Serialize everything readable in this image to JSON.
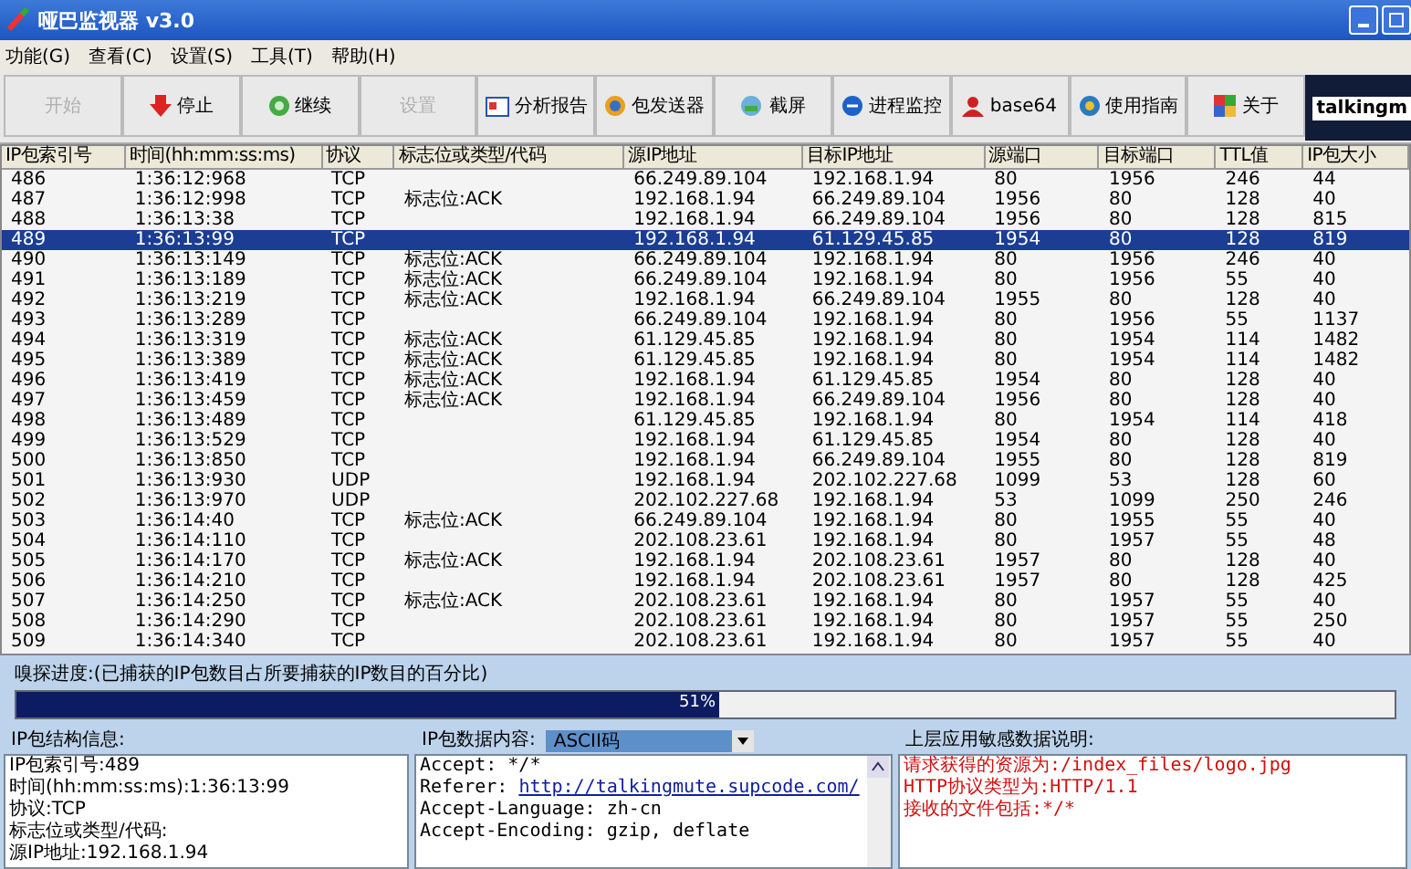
{
  "window": {
    "title": "哑巴监视器 v3.0"
  },
  "menu": [
    "功能(G)",
    "查看(C)",
    "设置(S)",
    "工具(T)",
    "帮助(H)"
  ],
  "toolbar": [
    {
      "label": "开始",
      "disabled": true
    },
    {
      "label": "停止",
      "disabled": false
    },
    {
      "label": "继续",
      "disabled": false
    },
    {
      "label": "设置",
      "disabled": true
    },
    {
      "label": "分析报告",
      "disabled": false
    },
    {
      "label": "包发送器",
      "disabled": false
    },
    {
      "label": "截屏",
      "disabled": false
    },
    {
      "label": "进程监控",
      "disabled": false
    },
    {
      "label": "base64",
      "disabled": false
    },
    {
      "label": "使用指南",
      "disabled": false
    },
    {
      "label": "关于",
      "disabled": false
    }
  ],
  "logo": "talkingm",
  "table": {
    "columns": [
      "IP包索引号",
      "时间(hh:mm:ss:ms)",
      "协议",
      "标志位或类型/代码",
      "源IP地址",
      "目标IP地址",
      "源端口",
      "目标端口",
      "TTL值",
      "IP包大小"
    ],
    "rows": [
      {
        "cells": [
          "486",
          "1:36:12:968",
          "TCP",
          "",
          "66.249.89.104",
          "192.168.1.94",
          "80",
          "1956",
          "246",
          "44"
        ],
        "selected": false
      },
      {
        "cells": [
          "487",
          "1:36:12:998",
          "TCP",
          "标志位:ACK",
          "192.168.1.94",
          "66.249.89.104",
          "1956",
          "80",
          "128",
          "40"
        ],
        "selected": false
      },
      {
        "cells": [
          "488",
          "1:36:13:38",
          "TCP",
          "",
          "192.168.1.94",
          "66.249.89.104",
          "1956",
          "80",
          "128",
          "815"
        ],
        "selected": false
      },
      {
        "cells": [
          "489",
          "1:36:13:99",
          "TCP",
          "",
          "192.168.1.94",
          "61.129.45.85",
          "1954",
          "80",
          "128",
          "819"
        ],
        "selected": true
      },
      {
        "cells": [
          "490",
          "1:36:13:149",
          "TCP",
          "标志位:ACK",
          "66.249.89.104",
          "192.168.1.94",
          "80",
          "1956",
          "246",
          "40"
        ],
        "selected": false
      },
      {
        "cells": [
          "491",
          "1:36:13:189",
          "TCP",
          "标志位:ACK",
          "66.249.89.104",
          "192.168.1.94",
          "80",
          "1956",
          "55",
          "40"
        ],
        "selected": false
      },
      {
        "cells": [
          "492",
          "1:36:13:219",
          "TCP",
          "标志位:ACK",
          "192.168.1.94",
          "66.249.89.104",
          "1955",
          "80",
          "128",
          "40"
        ],
        "selected": false
      },
      {
        "cells": [
          "493",
          "1:36:13:289",
          "TCP",
          "",
          "66.249.89.104",
          "192.168.1.94",
          "80",
          "1956",
          "55",
          "1137"
        ],
        "selected": false
      },
      {
        "cells": [
          "494",
          "1:36:13:319",
          "TCP",
          "标志位:ACK",
          "61.129.45.85",
          "192.168.1.94",
          "80",
          "1954",
          "114",
          "1482"
        ],
        "selected": false
      },
      {
        "cells": [
          "495",
          "1:36:13:389",
          "TCP",
          "标志位:ACK",
          "61.129.45.85",
          "192.168.1.94",
          "80",
          "1954",
          "114",
          "1482"
        ],
        "selected": false
      },
      {
        "cells": [
          "496",
          "1:36:13:419",
          "TCP",
          "标志位:ACK",
          "192.168.1.94",
          "61.129.45.85",
          "1954",
          "80",
          "128",
          "40"
        ],
        "selected": false
      },
      {
        "cells": [
          "497",
          "1:36:13:459",
          "TCP",
          "标志位:ACK",
          "192.168.1.94",
          "66.249.89.104",
          "1956",
          "80",
          "128",
          "40"
        ],
        "selected": false
      },
      {
        "cells": [
          "498",
          "1:36:13:489",
          "TCP",
          "",
          "61.129.45.85",
          "192.168.1.94",
          "80",
          "1954",
          "114",
          "418"
        ],
        "selected": false
      },
      {
        "cells": [
          "499",
          "1:36:13:529",
          "TCP",
          "",
          "192.168.1.94",
          "61.129.45.85",
          "1954",
          "80",
          "128",
          "40"
        ],
        "selected": false
      },
      {
        "cells": [
          "500",
          "1:36:13:850",
          "TCP",
          "",
          "192.168.1.94",
          "66.249.89.104",
          "1955",
          "80",
          "128",
          "819"
        ],
        "selected": false
      },
      {
        "cells": [
          "501",
          "1:36:13:930",
          "UDP",
          "",
          "192.168.1.94",
          "202.102.227.68",
          "1099",
          "53",
          "128",
          "60"
        ],
        "selected": false
      },
      {
        "cells": [
          "502",
          "1:36:13:970",
          "UDP",
          "",
          "202.102.227.68",
          "192.168.1.94",
          "53",
          "1099",
          "250",
          "246"
        ],
        "selected": false
      },
      {
        "cells": [
          "503",
          "1:36:14:40",
          "TCP",
          "标志位:ACK",
          "66.249.89.104",
          "192.168.1.94",
          "80",
          "1955",
          "55",
          "40"
        ],
        "selected": false
      },
      {
        "cells": [
          "504",
          "1:36:14:110",
          "TCP",
          "",
          "202.108.23.61",
          "192.168.1.94",
          "80",
          "1957",
          "55",
          "48"
        ],
        "selected": false
      },
      {
        "cells": [
          "505",
          "1:36:14:170",
          "TCP",
          "标志位:ACK",
          "192.168.1.94",
          "202.108.23.61",
          "1957",
          "80",
          "128",
          "40"
        ],
        "selected": false
      },
      {
        "cells": [
          "506",
          "1:36:14:210",
          "TCP",
          "",
          "192.168.1.94",
          "202.108.23.61",
          "1957",
          "80",
          "128",
          "425"
        ],
        "selected": false
      },
      {
        "cells": [
          "507",
          "1:36:14:250",
          "TCP",
          "标志位:ACK",
          "202.108.23.61",
          "192.168.1.94",
          "80",
          "1957",
          "55",
          "40"
        ],
        "selected": false
      },
      {
        "cells": [
          "508",
          "1:36:14:290",
          "TCP",
          "",
          "202.108.23.61",
          "192.168.1.94",
          "80",
          "1957",
          "55",
          "250"
        ],
        "selected": false
      },
      {
        "cells": [
          "509",
          "1:36:14:340",
          "TCP",
          "",
          "202.108.23.61",
          "192.168.1.94",
          "80",
          "1957",
          "55",
          "40"
        ],
        "selected": false
      }
    ]
  },
  "progress": {
    "label": "嗅探进度:(已捕获的IP包数目占所要捕获的IP数目的百分比)",
    "level": 0.51,
    "reading": "51%"
  },
  "structure_panel": {
    "title": "IP包结构信息:",
    "lines": [
      "IP包索引号:489",
      "时间(hh:mm:ss:ms):1:36:13:99",
      "协议:TCP",
      "标志位或类型/代码:",
      "源IP地址:192.168.1.94"
    ]
  },
  "data_panel": {
    "title": "IP包数据内容:",
    "encoding": "ASCII码",
    "lines": [
      {
        "kind": "text",
        "text": "Accept: */*"
      },
      {
        "kind": "link",
        "text": "Referer: ",
        "link": "http://talkingmute.supcode.com/"
      },
      {
        "kind": "text",
        "text": "Accept-Language: zh-cn"
      },
      {
        "kind": "text",
        "text": "Accept-Encoding: gzip, deflate"
      }
    ]
  },
  "sensitive_panel": {
    "title": "上层应用敏感数据说明:",
    "lines": [
      "请求获得的资源为:/index_files/logo.jpg",
      "HTTP协议类型为:HTTP/1.1",
      "接收的文件包括:*/*"
    ]
  }
}
